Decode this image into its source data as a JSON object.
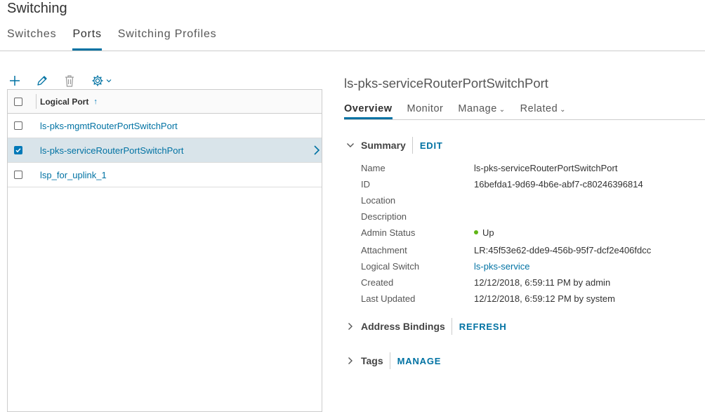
{
  "header": {
    "title": "Switching",
    "tabs": [
      {
        "label": "Switches",
        "active": false
      },
      {
        "label": "Ports",
        "active": true
      },
      {
        "label": "Switching Profiles",
        "active": false
      }
    ]
  },
  "toolbar": {
    "icons": [
      "plus-icon",
      "pencil-icon",
      "trash-icon",
      "gear-icon",
      "caret-down-icon"
    ]
  },
  "grid": {
    "column_header": "Logical Port",
    "sort_indicator": "↑",
    "rows": [
      {
        "label": "ls-pks-mgmtRouterPortSwitchPort",
        "checked": false,
        "selected": false
      },
      {
        "label": "ls-pks-serviceRouterPortSwitchPort",
        "checked": true,
        "selected": true
      },
      {
        "label": "lsp_for_uplink_1",
        "checked": false,
        "selected": false
      }
    ]
  },
  "detail": {
    "title": "ls-pks-serviceRouterPortSwitchPort",
    "tabs": [
      {
        "label": "Overview",
        "active": true,
        "caret": ""
      },
      {
        "label": "Monitor",
        "active": false,
        "caret": ""
      },
      {
        "label": "Manage",
        "active": false,
        "caret": "⌄"
      },
      {
        "label": "Related",
        "active": false,
        "caret": "⌄"
      }
    ],
    "summary": {
      "title": "Summary",
      "action": "EDIT",
      "properties": [
        {
          "key": "Name",
          "value": "ls-pks-serviceRouterPortSwitchPort"
        },
        {
          "key": "ID",
          "value": "16befda1-9d69-4b6e-abf7-c80246396814"
        },
        {
          "key": "Location",
          "value": ""
        },
        {
          "key": "Description",
          "value": ""
        },
        {
          "key": "Admin Status",
          "value": "Up"
        },
        {
          "key": "Attachment",
          "value": "LR:45f53e62-dde9-456b-95f7-dcf2e406fdcc"
        },
        {
          "key": "Logical Switch",
          "value": "ls-pks-service"
        },
        {
          "key": "Created",
          "value": "12/12/2018, 6:59:11 PM by admin"
        },
        {
          "key": "Last Updated",
          "value": "12/12/2018, 6:59:12 PM by system"
        }
      ]
    },
    "address_bindings": {
      "title": "Address Bindings",
      "action": "REFRESH"
    },
    "tags": {
      "title": "Tags",
      "action": "MANAGE"
    }
  },
  "colors": {
    "accent": "#0072a3",
    "status_up": "#60b515",
    "selected_row": "#d9e4ea"
  }
}
